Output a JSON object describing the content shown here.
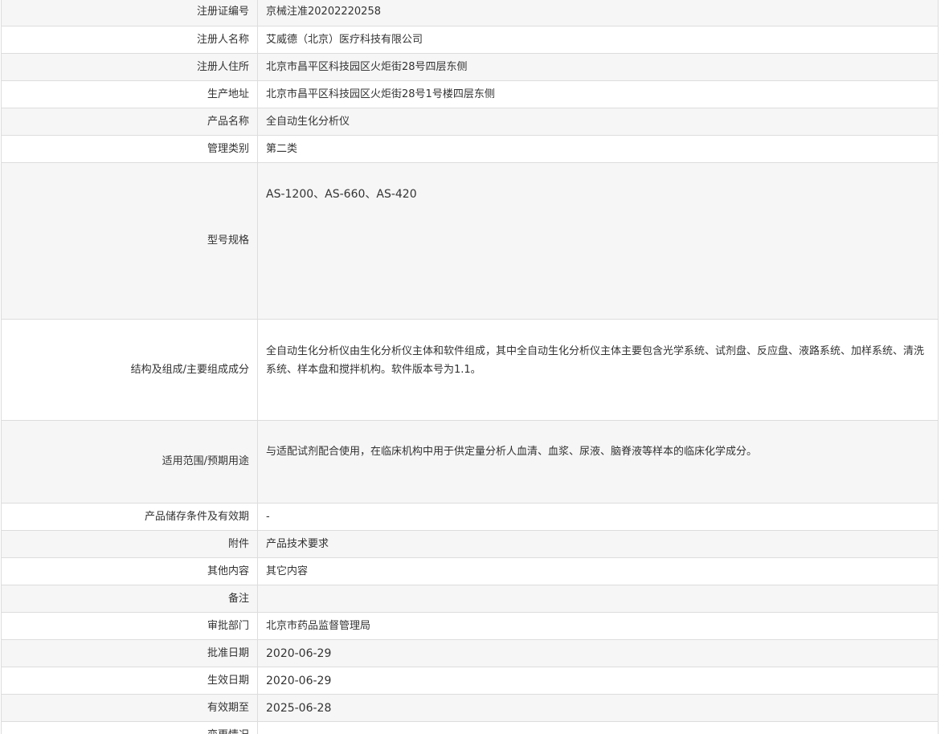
{
  "rows": [
    {
      "label": "注册证编号",
      "value": "京械注准20202220258"
    },
    {
      "label": "注册人名称",
      "value": "艾威德（北京）医疗科技有限公司"
    },
    {
      "label": "注册人住所",
      "value": "北京市昌平区科技园区火炬街28号四层东侧"
    },
    {
      "label": "生产地址",
      "value": "北京市昌平区科技园区火炬街28号1号楼四层东侧"
    },
    {
      "label": "产品名称",
      "value": "全自动生化分析仪"
    },
    {
      "label": "管理类别",
      "value": "第二类"
    },
    {
      "label": "型号规格",
      "value": "AS-1200、AS-660、AS-420"
    },
    {
      "label": "结构及组成/主要组成成分",
      "value": "全自动生化分析仪由生化分析仪主体和软件组成，其中全自动生化分析仪主体主要包含光学系统、试剂盘、反应盘、液路系统、加样系统、清洗系统、样本盘和搅拌机构。软件版本号为1.1。"
    },
    {
      "label": "适用范围/预期用途",
      "value": "与适配试剂配合使用，在临床机构中用于供定量分析人血清、血浆、尿液、脑脊液等样本的临床化学成分。"
    },
    {
      "label": "产品储存条件及有效期",
      "value": "-"
    },
    {
      "label": "附件",
      "value": "产品技术要求"
    },
    {
      "label": "其他内容",
      "value": "其它内容"
    },
    {
      "label": "备注",
      "value": ""
    },
    {
      "label": "审批部门",
      "value": "北京市药品监督管理局"
    },
    {
      "label": "批准日期",
      "value": "2020-06-29"
    },
    {
      "label": "生效日期",
      "value": "2020-06-29"
    },
    {
      "label": "有效期至",
      "value": "2025-06-28"
    },
    {
      "label": "变更情况",
      "value": ""
    }
  ]
}
